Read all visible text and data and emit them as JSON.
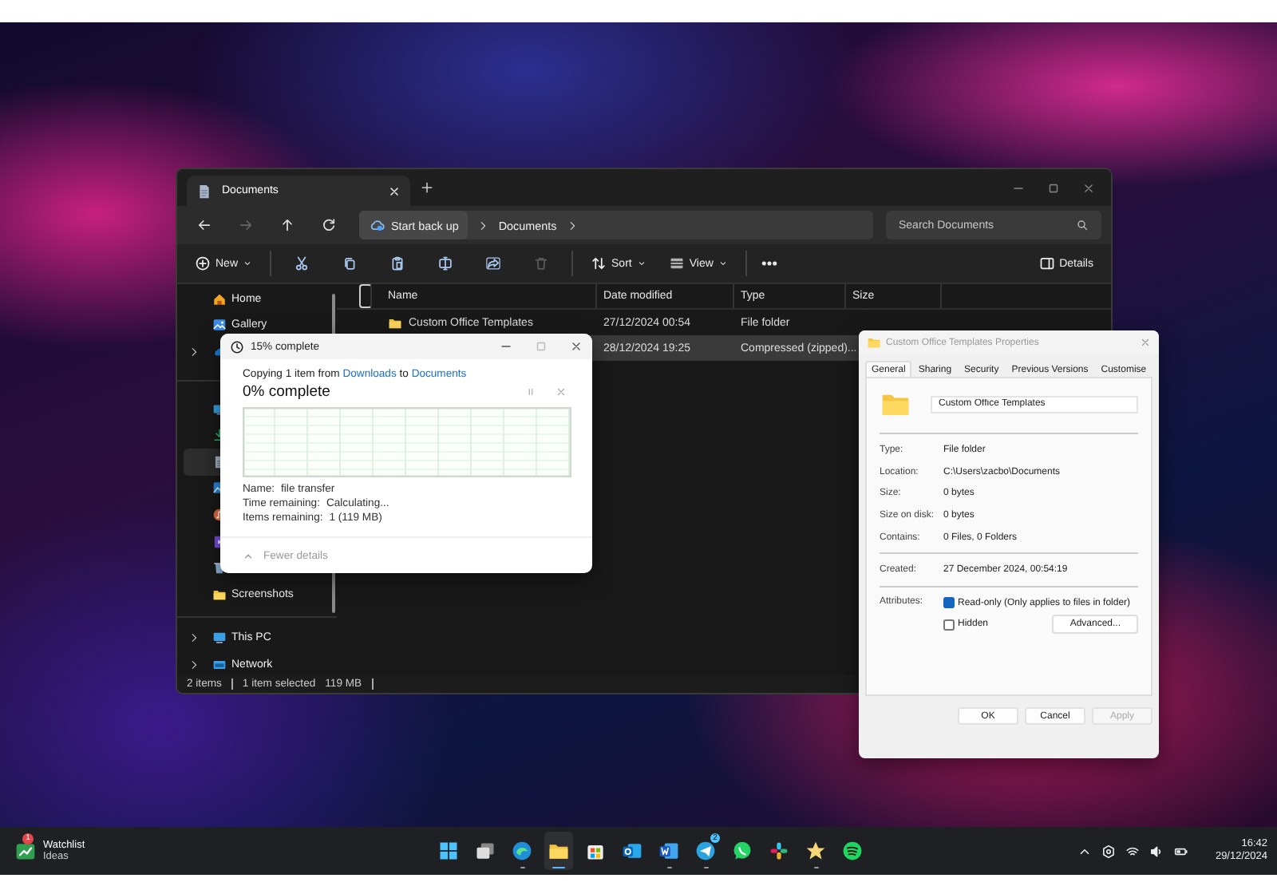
{
  "explorer": {
    "tabs": [
      {
        "title": "Documents",
        "selected": true
      }
    ],
    "nav": [
      {
        "disabled": false
      },
      {
        "disabled": true
      },
      {
        "disabled": false
      },
      {
        "disabled": false
      }
    ],
    "breadcrumb": {
      "chip": "Start back up",
      "segments": [
        "Documents"
      ]
    },
    "search": {
      "placeholder": "Search Documents"
    },
    "toolbar": {
      "new": "New",
      "actions": [
        {
          "disabled": false
        },
        {
          "disabled": false
        },
        {
          "disabled": false
        },
        {
          "disabled": false
        },
        {
          "disabled": false
        },
        {
          "disabled": true
        }
      ],
      "sort": "Sort",
      "view": "View",
      "details": "Details"
    },
    "sidebar": {
      "sections": [
        {
          "items": [
            {
              "label": "Home",
              "selected": false,
              "expandable": false
            },
            {
              "label": "Gallery",
              "selected": false,
              "expandable": false
            },
            {
              "selected": false,
              "expandable": true
            }
          ]
        },
        {
          "items": [
            {
              "selected": false,
              "expandable": false
            },
            {
              "selected": false,
              "expandable": false
            },
            {
              "selected": true,
              "expandable": false
            },
            {
              "selected": false,
              "expandable": false
            },
            {
              "selected": false,
              "expandable": false
            },
            {
              "selected": false,
              "expandable": false
            },
            {
              "selected": false,
              "expandable": false
            },
            {
              "label": "Screenshots",
              "selected": false,
              "expandable": false
            }
          ]
        },
        {
          "items": [
            {
              "label": "This PC",
              "selected": false,
              "expandable": true
            },
            {
              "label": "Network",
              "selected": false,
              "expandable": true
            }
          ]
        }
      ]
    },
    "file_list": {
      "select_all": {
        "checked": false
      },
      "columns": [
        "Name",
        "Date modified",
        "Type",
        "Size"
      ],
      "rows": [
        {
          "name": "Custom Office Templates",
          "date_modified": "27/12/2024 00:54",
          "type": "File folder",
          "selected": false
        },
        {
          "date_modified": "28/12/2024 19:25",
          "type": "Compressed (zipped)...",
          "selected": true
        }
      ]
    },
    "status_bar": [
      "2 items",
      "1 item selected",
      "119 MB"
    ]
  },
  "copy_dialog": {
    "title": "15% complete",
    "copying": {
      "prefix": "Copying 1 item from",
      "source": "Downloads",
      "joiner": "to",
      "destination": "Documents"
    },
    "progress_title": "0% complete",
    "details": [
      {
        "label": "Name:",
        "value": "file transfer"
      },
      {
        "label": "Time remaining:",
        "value": "Calculating..."
      },
      {
        "label": "Items remaining:",
        "value": "1 (119 MB)"
      }
    ],
    "toggle": "Fewer details"
  },
  "properties_dialog": {
    "title": "Custom Office Templates Properties",
    "tabs": [
      {
        "label": "General",
        "selected": true
      },
      {
        "label": "Sharing",
        "selected": false
      },
      {
        "label": "Security",
        "selected": false
      },
      {
        "label": "Previous Versions",
        "selected": false
      },
      {
        "label": "Customise",
        "selected": false
      }
    ],
    "name_value": "Custom Office Templates",
    "groups": [
      [
        {
          "label": "Type:",
          "value": "File folder"
        },
        {
          "label": "Location:",
          "value": "C:\\Users\\zacbo\\Documents"
        },
        {
          "label": "Size:",
          "value": "0 bytes"
        },
        {
          "label": "Size on disk:",
          "value": "0 bytes"
        },
        {
          "label": "Contains:",
          "value": "0 Files, 0 Folders"
        }
      ],
      [
        {
          "label": "Created:",
          "value": "27 December 2024, 00:54:19"
        }
      ]
    ],
    "attributes": {
      "label": "Attributes:",
      "options": [
        {
          "label": "Read-only (Only applies to files in folder)",
          "checked": true
        },
        {
          "label": "Hidden",
          "checked": false
        }
      ],
      "advanced": "Advanced..."
    },
    "buttons": [
      {
        "label": "OK",
        "disabled": false
      },
      {
        "label": "Cancel",
        "disabled": false
      },
      {
        "label": "Apply",
        "disabled": true
      }
    ]
  },
  "taskbar": {
    "widget": {
      "title": "Watchlist",
      "subtitle": "Ideas",
      "badge": "1"
    },
    "apps": [
      {
        "running": false,
        "active": false
      },
      {
        "running": false,
        "active": false
      },
      {
        "running": true,
        "active": false
      },
      {
        "running": true,
        "active": true
      },
      {
        "running": false,
        "active": false
      },
      {
        "running": false,
        "active": false
      },
      {
        "running": true,
        "active": false
      },
      {
        "running": true,
        "active": false,
        "badge": "2"
      },
      {
        "running": false,
        "active": false
      },
      {
        "running": false,
        "active": false
      },
      {
        "running": true,
        "active": false
      },
      {
        "running": false,
        "active": false
      }
    ],
    "clock": {
      "time": "16:42",
      "date": "29/12/2024"
    }
  }
}
